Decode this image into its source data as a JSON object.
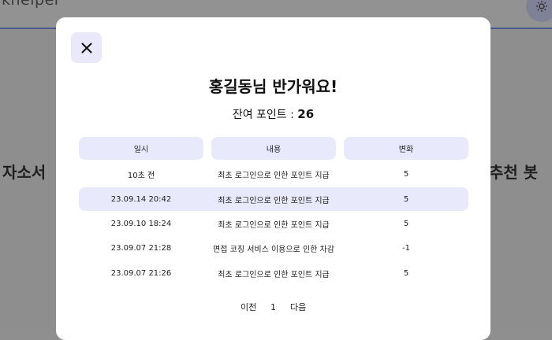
{
  "background": {
    "logo_text": "khelper",
    "left_text": "자소서",
    "right_text": "추천 봇"
  },
  "modal": {
    "greeting": "홍길동님 반가워요!",
    "points_label": "잔여 포인트 : ",
    "points_value": "26",
    "table": {
      "headers": [
        "일시",
        "내용",
        "변화"
      ],
      "rows": [
        {
          "time": "10초 전",
          "content": "최초 로그인으로 인한 포인트 지급",
          "change": "5",
          "highlighted": false
        },
        {
          "time": "23.09.14 20:42",
          "content": "최초 로그인으로 인한 포인트 지급",
          "change": "5",
          "highlighted": true
        },
        {
          "time": "23.09.10 18:24",
          "content": "최초 로그인으로 인한 포인트 지급",
          "change": "5",
          "highlighted": false
        },
        {
          "time": "23.09.07 21:28",
          "content": "면접 코칭 서비스 이용으로 인한 차감",
          "change": "-1",
          "highlighted": false
        },
        {
          "time": "23.09.07 21:26",
          "content": "최초 로그인으로 인한 포인트 지급",
          "change": "5",
          "highlighted": false
        }
      ]
    },
    "pagination": {
      "prev_label": "이전",
      "current_page": "1",
      "next_label": "다음"
    }
  },
  "colors": {
    "accent_soft": "#e8e9fa",
    "overlay": "#8e8e8e"
  },
  "icons": {
    "close": "close-icon",
    "settings": "gear-icon"
  }
}
